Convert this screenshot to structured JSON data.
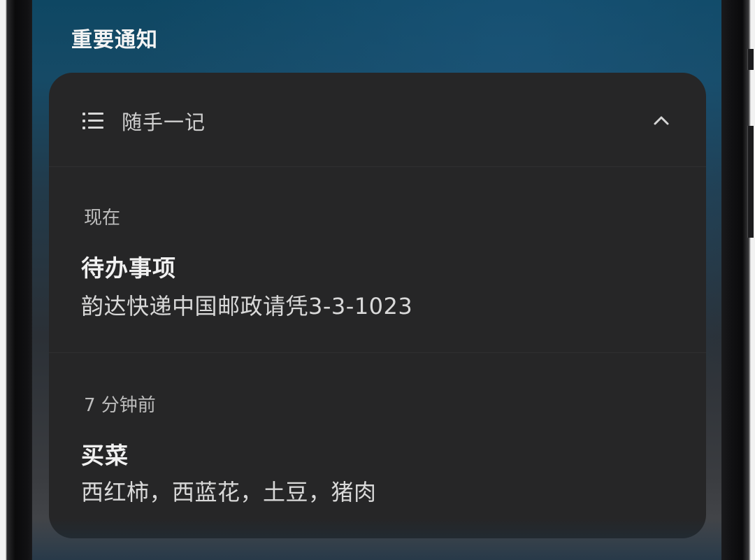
{
  "section": {
    "title": "重要通知"
  },
  "card": {
    "app_name": "随手一记",
    "icons": {
      "app": "list-icon",
      "collapse": "chevron-up-icon"
    },
    "notifications": [
      {
        "time": "现在",
        "title": "待办事项",
        "body": "韵达快递中国邮政请凭3-3-1023"
      },
      {
        "time": "7 分钟前",
        "title": "买菜",
        "body": "西红柿，西蓝花，土豆，猪肉"
      }
    ]
  },
  "colors": {
    "card_background": "#262627",
    "title_text": "#f1f1f1",
    "secondary_text": "#bdbdbd",
    "wallpaper_top": "#0e4763"
  }
}
